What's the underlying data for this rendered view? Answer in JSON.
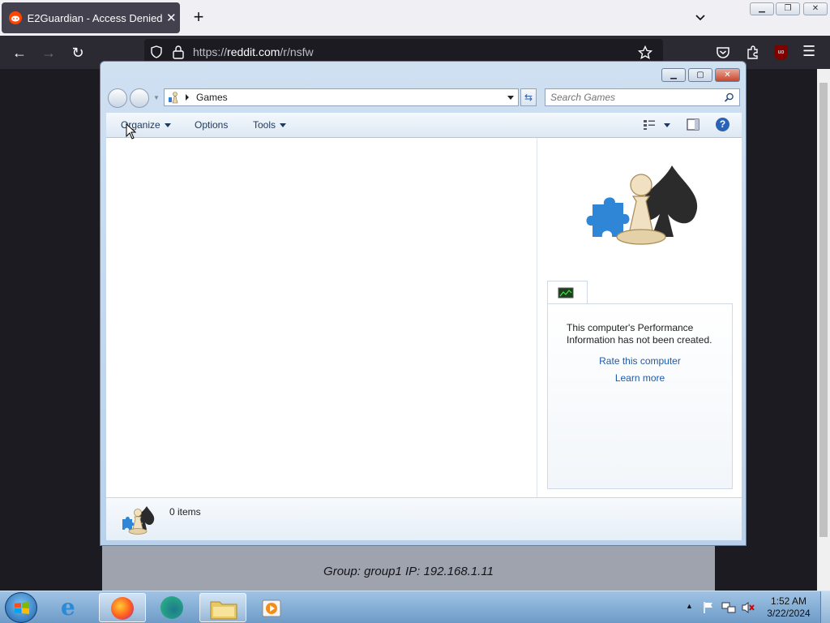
{
  "browser": {
    "tab_title": "E2Guardian - Access Denied",
    "tab_close": "✕",
    "new_tab": "+",
    "url_scheme": "https://",
    "url_host": "reddit.com",
    "url_path": "/r/nsfw"
  },
  "page": {
    "group_info": "Group: group1   IP: 192.168.1.11"
  },
  "games_window": {
    "address": "Games",
    "search_placeholder": "Search Games",
    "toolbar": {
      "organize": "Organize",
      "options": "Options",
      "tools": "Tools"
    },
    "perf_text": "This computer's Performance Information has not been created.",
    "rate_link": "Rate this computer",
    "learn_link": "Learn more",
    "item_count": "0 items"
  },
  "taskbar": {
    "time": "1:52 AM",
    "date": "3/22/2024"
  },
  "colors": {
    "reddit": "#ff4500",
    "link": "#1e5aa8"
  }
}
